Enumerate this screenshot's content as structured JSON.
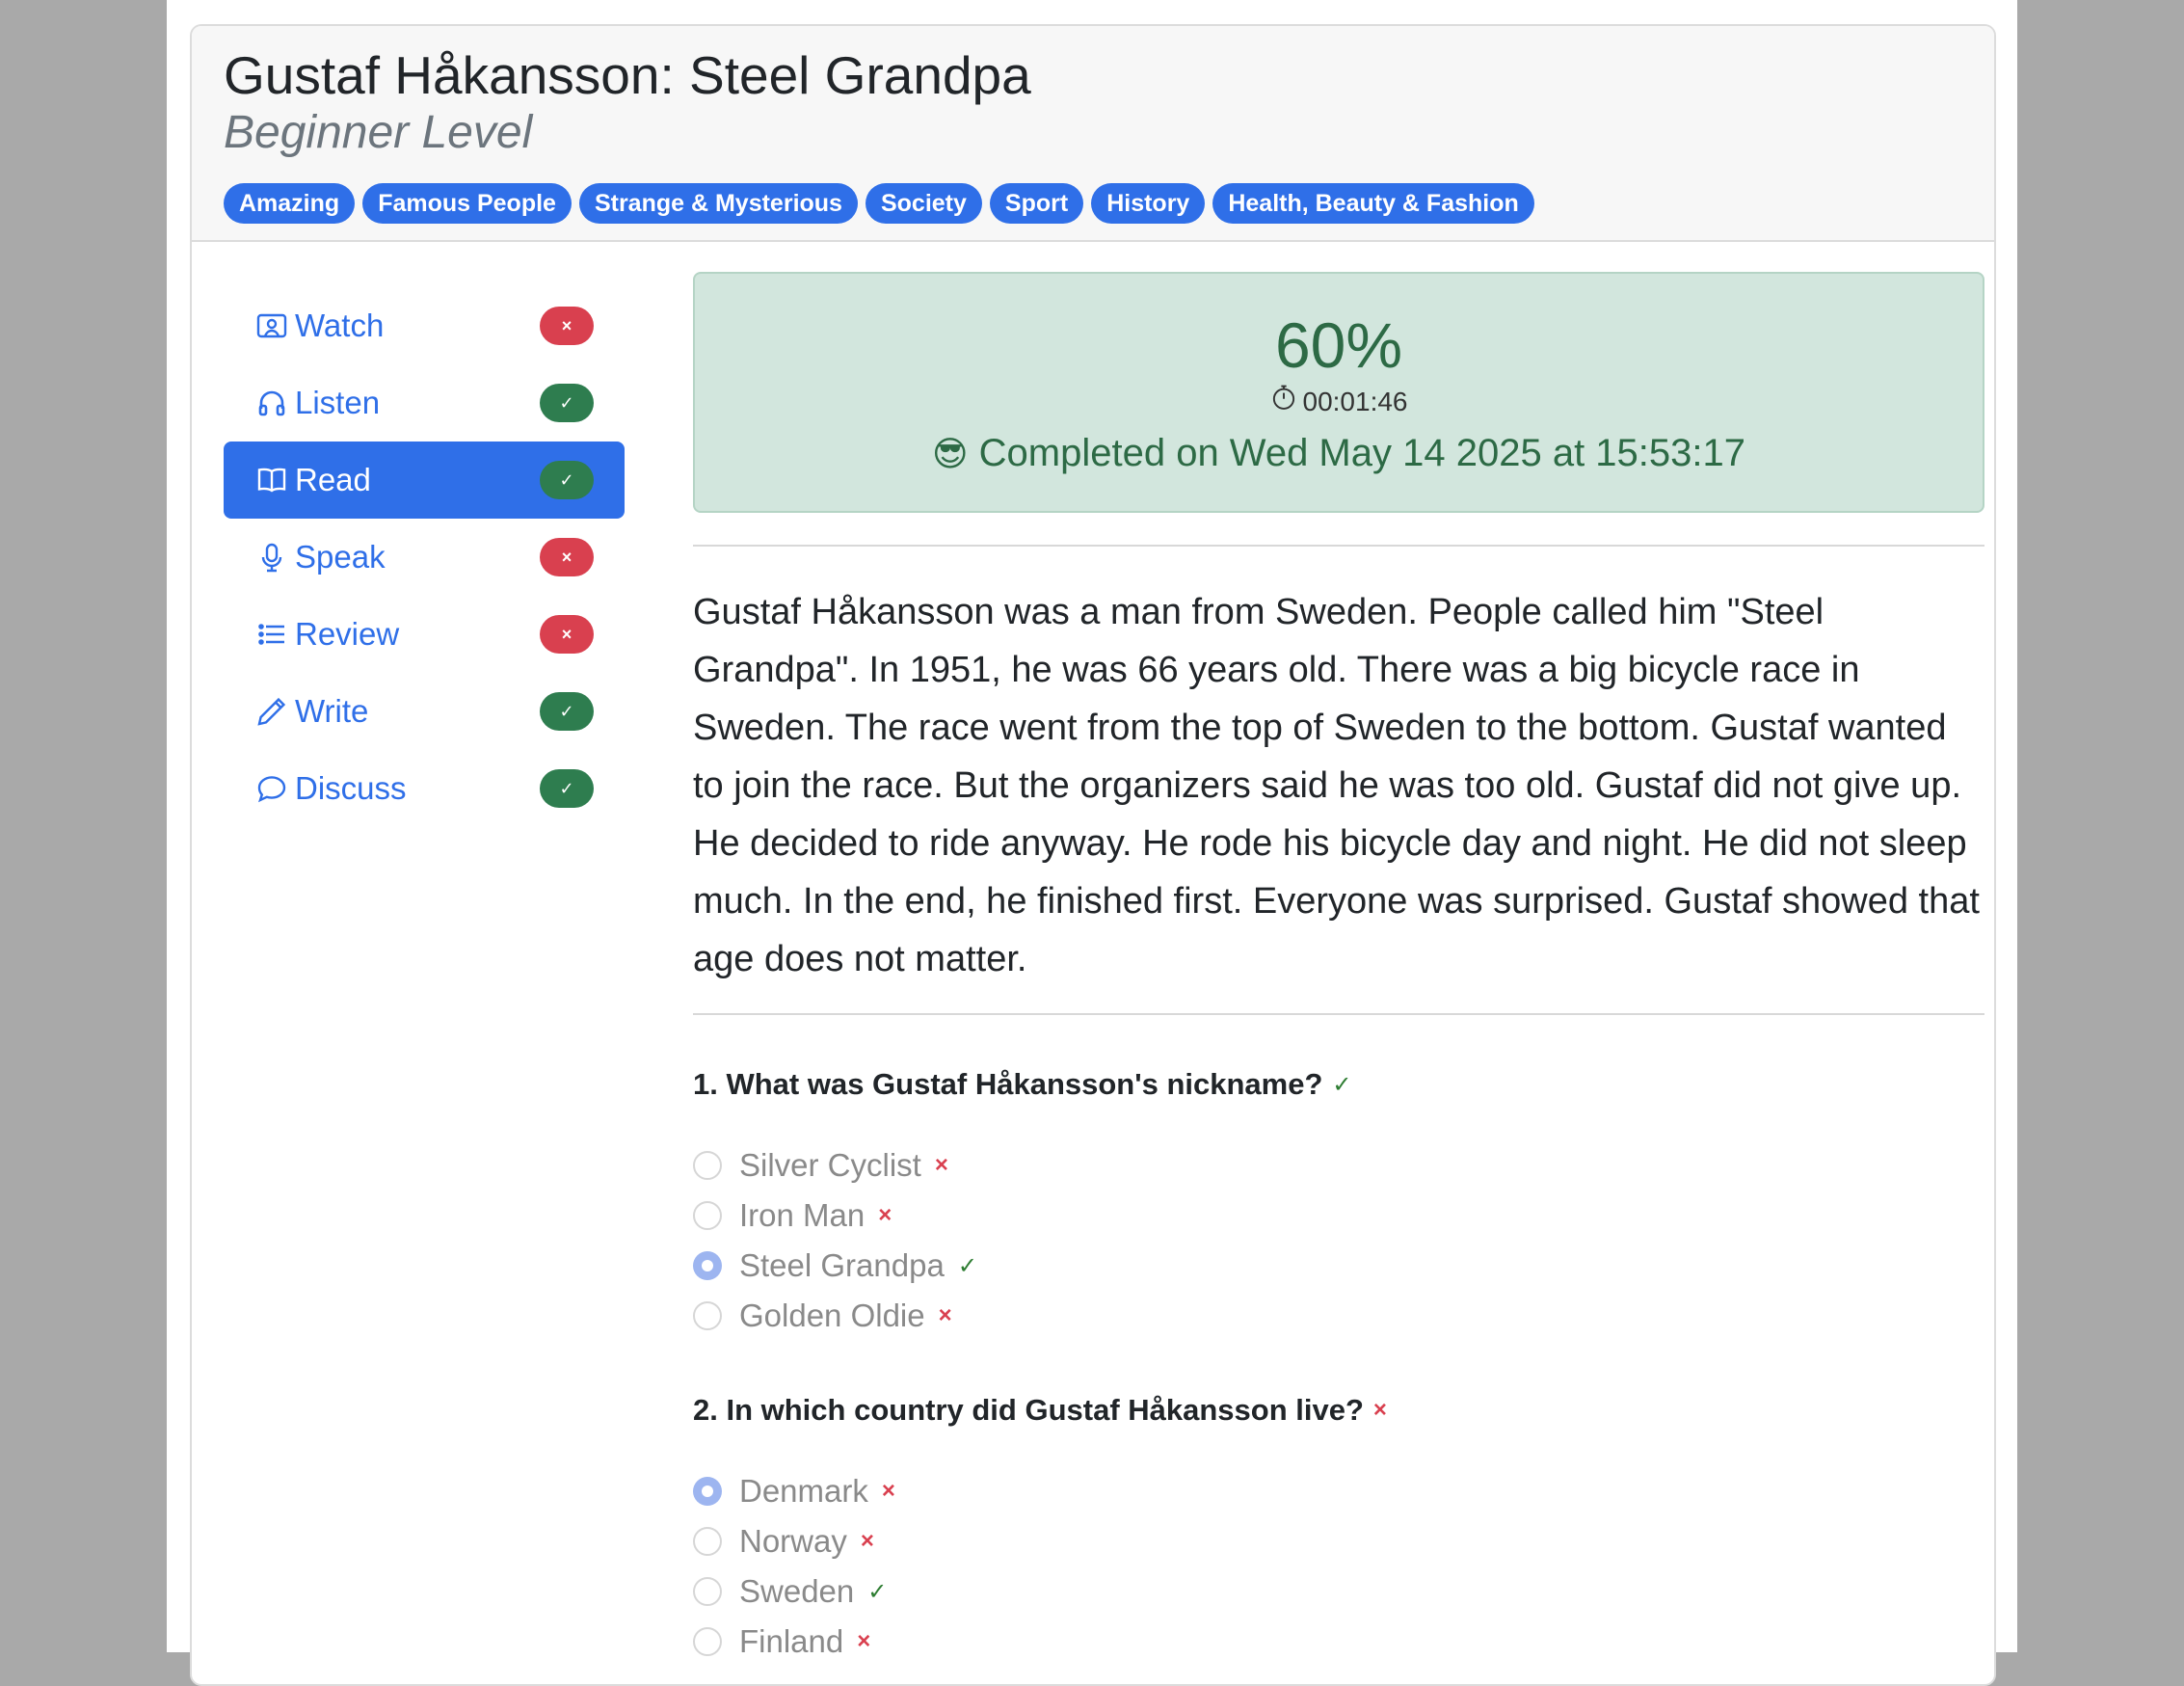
{
  "header": {
    "title": "Gustaf Håkansson: Steel Grandpa",
    "level": "Beginner Level",
    "tags": [
      "Amazing",
      "Famous People",
      "Strange & Mysterious",
      "Society",
      "Sport",
      "History",
      "Health, Beauty & Fashion"
    ]
  },
  "nav": {
    "items": [
      {
        "label": "Watch",
        "icon": "person-video-icon",
        "status": "×",
        "state": "bad"
      },
      {
        "label": "Listen",
        "icon": "headphones-icon",
        "status": "✓",
        "state": "good"
      },
      {
        "label": "Read",
        "icon": "book-icon",
        "status": "✓",
        "state": "good",
        "active": true
      },
      {
        "label": "Speak",
        "icon": "microphone-icon",
        "status": "×",
        "state": "bad"
      },
      {
        "label": "Review",
        "icon": "list-icon",
        "status": "×",
        "state": "bad"
      },
      {
        "label": "Write",
        "icon": "pencil-icon",
        "status": "✓",
        "state": "good"
      },
      {
        "label": "Discuss",
        "icon": "chat-bubble-icon",
        "status": "✓",
        "state": "good"
      }
    ]
  },
  "result": {
    "score": "60%",
    "time": "00:01:46",
    "emoji": "😎",
    "completed": "Completed on Wed May 14 2025 at 15:53:17"
  },
  "reading": {
    "text": "Gustaf Håkansson was a man from Sweden. People called him \"Steel Grandpa\". In 1951, he was 66 years old. There was a big bicycle race in Sweden. The race went from the top of Sweden to the bottom. Gustaf wanted to join the race. But the organizers said he was too old. Gustaf did not give up. He decided to ride anyway. He rode his bicycle day and night. He did not sleep much. In the end, he finished first. Everyone was surprised. Gustaf showed that age does not matter."
  },
  "questions": [
    {
      "text": "1. What was Gustaf Håkansson's nickname?",
      "mark": "✓",
      "correct": true,
      "options": [
        {
          "label": "Silver Cyclist",
          "mark": "×",
          "selected": false
        },
        {
          "label": "Iron Man",
          "mark": "×",
          "selected": false
        },
        {
          "label": "Steel Grandpa",
          "mark": "✓",
          "selected": true
        },
        {
          "label": "Golden Oldie",
          "mark": "×",
          "selected": false
        }
      ]
    },
    {
      "text": "2. In which country did Gustaf Håkansson live?",
      "mark": "×",
      "correct": false,
      "options": [
        {
          "label": "Denmark",
          "mark": "×",
          "selected": true
        },
        {
          "label": "Norway",
          "mark": "×",
          "selected": false
        },
        {
          "label": "Sweden",
          "mark": "✓",
          "selected": false
        },
        {
          "label": "Finland",
          "mark": "×",
          "selected": false
        }
      ]
    }
  ],
  "colors": {
    "primary": "#2f6fe8",
    "success": "#2e7d4f",
    "danger": "#d9404f",
    "success_bg": "#d2e6dd"
  }
}
